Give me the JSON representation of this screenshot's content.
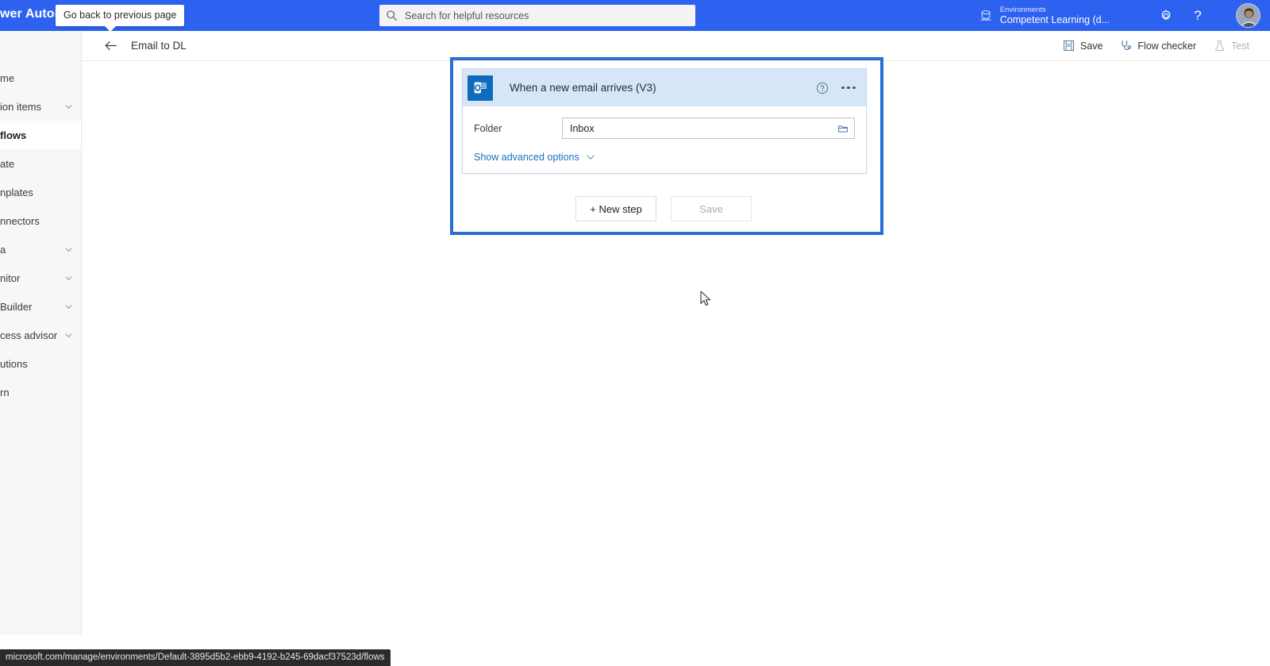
{
  "suitebar": {
    "brand": "wer Automa",
    "search": {
      "placeholder": "Search for helpful resources",
      "icon": "search-icon"
    },
    "environment": {
      "label": "Environments",
      "name": "Competent Learning (d...",
      "icon": "environment-database-icon"
    },
    "settings_icon": "gear-icon",
    "help_icon": "help-question-icon",
    "help_glyph": "?",
    "avatar": "user-avatar"
  },
  "tooltip": {
    "text": "Go back to previous page"
  },
  "sidebar": {
    "items": [
      {
        "label": "me",
        "expandable": false,
        "selected": false
      },
      {
        "label": "ion items",
        "expandable": true,
        "selected": false
      },
      {
        "label": "flows",
        "expandable": false,
        "selected": true
      },
      {
        "label": "ate",
        "expandable": false,
        "selected": false
      },
      {
        "label": "nplates",
        "expandable": false,
        "selected": false
      },
      {
        "label": "nnectors",
        "expandable": false,
        "selected": false
      },
      {
        "label": "a",
        "expandable": true,
        "selected": false
      },
      {
        "label": "nitor",
        "expandable": true,
        "selected": false
      },
      {
        "label": "Builder",
        "expandable": true,
        "selected": false
      },
      {
        "label": "cess advisor",
        "expandable": true,
        "selected": false
      },
      {
        "label": "utions",
        "expandable": false,
        "selected": false
      },
      {
        "label": "rn",
        "expandable": false,
        "selected": false
      }
    ]
  },
  "commandbar": {
    "back_icon": "back-arrow-icon",
    "title": "Email to DL",
    "save": {
      "label": "Save",
      "icon": "save-floppy-icon",
      "disabled": false
    },
    "flow_checker": {
      "label": "Flow checker",
      "icon": "stethoscope-icon",
      "disabled": false
    },
    "test": {
      "label": "Test",
      "icon": "flask-icon",
      "disabled": true
    }
  },
  "designer": {
    "trigger_card": {
      "title": "When a new email arrives (V3)",
      "connector_icon": "outlook-365-icon",
      "help_icon": "circle-question-icon",
      "more_icon": "ellipsis-icon",
      "fields": [
        {
          "label": "Folder",
          "value": "Inbox",
          "picker_icon": "folder-picker-icon"
        }
      ],
      "advanced": {
        "label": "Show advanced options",
        "icon": "chevron-down-icon"
      }
    },
    "new_step_button": "+ New step",
    "save_button": {
      "label": "Save",
      "disabled": true
    }
  },
  "statusbar": {
    "url": "microsoft.com/manage/environments/Default-3895d5b2-ebb9-4192-b245-69dacf37523d/flows"
  },
  "colors": {
    "suitebar": "#2c62ef",
    "selection_border": "#2a6fd1",
    "card_header": "#d7e6f7",
    "link": "#1a6fc4",
    "connector": "#0f6cbd"
  }
}
